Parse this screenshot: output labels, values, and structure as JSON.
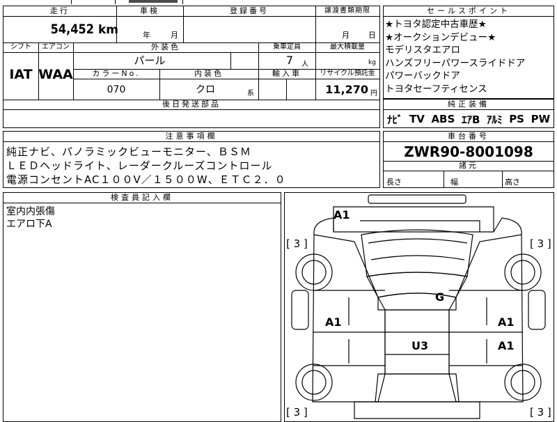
{
  "top": {
    "mileage_label": "走行",
    "inspection_label": "車検",
    "registration_label": "登録番号",
    "transfer_label": "譲渡書類期限",
    "mileage_value": "54,452",
    "mileage_unit": "km",
    "year_unit": "年",
    "month_unit": "月",
    "transfer_month": "月",
    "transfer_day": "日"
  },
  "spec": {
    "shift_label": "シフト",
    "aircon_label": "エアコン",
    "exterior_label": "外装色",
    "capacity_label": "乗車定員",
    "maxload_label": "最大積載量",
    "shift_value": "IAT",
    "aircon_value": "WAA",
    "exterior_value": "パール",
    "capacity_value": "7",
    "capacity_unit": "人",
    "maxload_unit": "kg",
    "colorno_label": "カラーNo.",
    "interior_label": "内装色",
    "import_label": "輸入車",
    "recycle_label": "リサイクル預託金",
    "colorno_value": "070",
    "interior_value": "クロ",
    "interior_suffix": "系",
    "recycle_value": "11,270",
    "recycle_unit": "円",
    "delivery_label": "後日発送部品"
  },
  "sales": {
    "header": "セールスポイント",
    "lines": [
      "★トヨタ認定中古車歴★",
      "★オークションデビュー★",
      "モデリスタエアロ",
      "ハンズフリーパワースライドドア",
      "パワーバックドア",
      "トヨタセーフティセンス"
    ]
  },
  "equipment": {
    "header": "純正装備",
    "items": [
      "ﾅﾋﾞ",
      "TV",
      "ABS",
      "ｴｱB",
      "ｱﾙﾐ",
      "PS",
      "PW"
    ]
  },
  "notes": {
    "header": "注意事項欄",
    "lines": [
      "純正ナビ、パノラミックビューモニター、ＢＳＭ",
      "ＬＥＤヘッドライト、レーダークルーズコントロール",
      "電源コンセントAC１００V／１５００W、ＥＴＣ２．０"
    ]
  },
  "chassis": {
    "header": "車台番号",
    "value": "ZWR90-8001098",
    "dims_header": "諸元",
    "length_label": "長さ",
    "width_label": "幅",
    "height_label": "高さ"
  },
  "inspector": {
    "header": "検査員記入欄",
    "lines": [
      "室内内張傷",
      "エアロ下A"
    ]
  },
  "diagram": {
    "marks": {
      "front": "A1",
      "roof": "G",
      "left_door": "A1",
      "right_front": "A1",
      "right_rear": "A1",
      "floor": "U3",
      "tire_fl": "[ 3 ]",
      "tire_fr": "[ 3 ]",
      "tire_rl": "[ 3 ]",
      "tire_rr": "[ 3 ]"
    }
  }
}
